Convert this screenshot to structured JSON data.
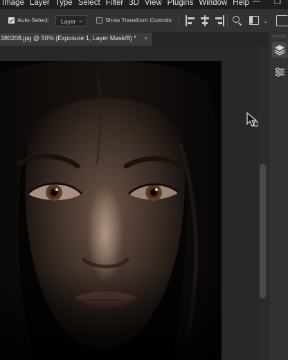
{
  "menubar": {
    "items": [
      "Image",
      "Layer",
      "Type",
      "Select",
      "Filter",
      "3D",
      "View",
      "Plugins",
      "Window",
      "Help"
    ]
  },
  "options": {
    "auto_select_label": "Auto-Select:",
    "auto_select_checked": true,
    "auto_select_target": "Layer",
    "show_transform_label": "Show Transform Controls",
    "show_transform_checked": false
  },
  "document_tab": {
    "title": "380208.jpg @ 50% (Exposure 1, Layer Mask/8) *",
    "close_glyph": "×"
  },
  "colors": {
    "menubar_bg": "#1f1f1f",
    "optionsbar_bg": "#323232",
    "canvas_bg": "#282828",
    "tab_active_bg": "#3b3b3b"
  },
  "icons": {
    "auto_select_checkbox": "checkbox-checked-icon",
    "transform_checkbox": "checkbox-empty-icon",
    "align_left": "align-left-edges-icon",
    "align_hcenter": "align-horizontal-centers-icon",
    "align_right": "align-right-edges-icon",
    "search": "search-icon",
    "workspace": "workspace-layout-icon",
    "share": "share-icon",
    "layers_panel": "layers-icon",
    "adjustments_panel": "adjustments-sliders-icon",
    "cursor": "move-cursor-icon"
  }
}
